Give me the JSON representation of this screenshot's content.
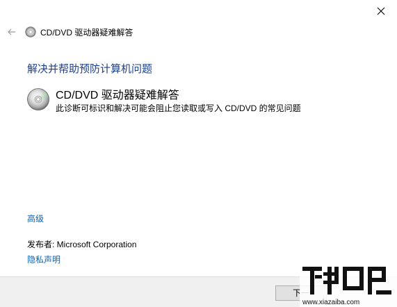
{
  "window": {
    "title": "CD/DVD 驱动器疑难解答",
    "close_icon": "close-icon",
    "back_icon": "back-arrow-icon",
    "disc_icon": "cd-disc-icon"
  },
  "main": {
    "heading": "解决并帮助预防计算机问题",
    "item": {
      "title": "CD/DVD 驱动器疑难解答",
      "description": "此诊断可标识和解决可能会阻止您读取或写入 CD/DVD 的常见问题"
    },
    "advanced_link": "高级",
    "publisher": "发布者:  Microsoft Corporation",
    "privacy_link": "隐私声明"
  },
  "footer": {
    "next_label": "下一"
  },
  "watermark": {
    "brand": "下载吧",
    "url": "www.xiazaiba.com"
  },
  "colors": {
    "heading": "#1e3f8a",
    "link": "#0b63b8"
  }
}
